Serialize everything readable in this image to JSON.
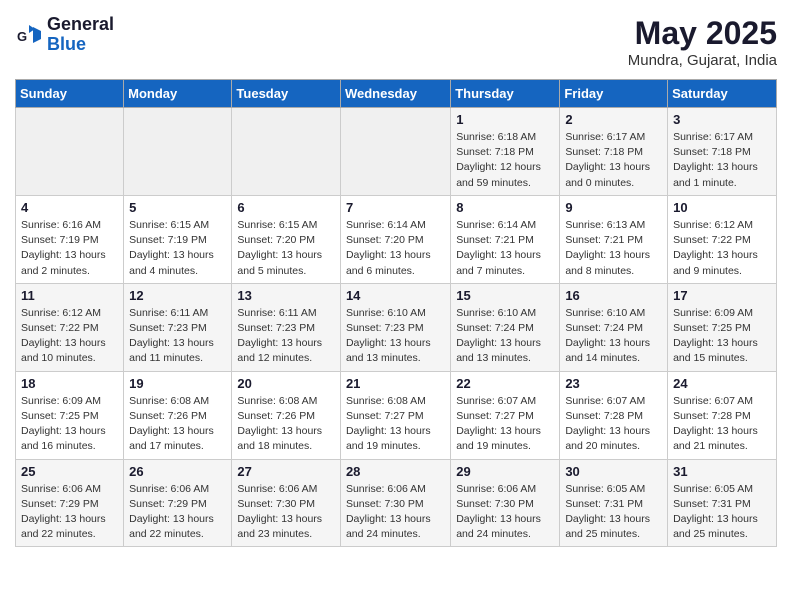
{
  "header": {
    "logo_line1": "General",
    "logo_line2": "Blue",
    "month": "May 2025",
    "location": "Mundra, Gujarat, India"
  },
  "weekdays": [
    "Sunday",
    "Monday",
    "Tuesday",
    "Wednesday",
    "Thursday",
    "Friday",
    "Saturday"
  ],
  "weeks": [
    [
      {
        "day": "",
        "info": ""
      },
      {
        "day": "",
        "info": ""
      },
      {
        "day": "",
        "info": ""
      },
      {
        "day": "",
        "info": ""
      },
      {
        "day": "1",
        "info": "Sunrise: 6:18 AM\nSunset: 7:18 PM\nDaylight: 12 hours\nand 59 minutes."
      },
      {
        "day": "2",
        "info": "Sunrise: 6:17 AM\nSunset: 7:18 PM\nDaylight: 13 hours\nand 0 minutes."
      },
      {
        "day": "3",
        "info": "Sunrise: 6:17 AM\nSunset: 7:18 PM\nDaylight: 13 hours\nand 1 minute."
      }
    ],
    [
      {
        "day": "4",
        "info": "Sunrise: 6:16 AM\nSunset: 7:19 PM\nDaylight: 13 hours\nand 2 minutes."
      },
      {
        "day": "5",
        "info": "Sunrise: 6:15 AM\nSunset: 7:19 PM\nDaylight: 13 hours\nand 4 minutes."
      },
      {
        "day": "6",
        "info": "Sunrise: 6:15 AM\nSunset: 7:20 PM\nDaylight: 13 hours\nand 5 minutes."
      },
      {
        "day": "7",
        "info": "Sunrise: 6:14 AM\nSunset: 7:20 PM\nDaylight: 13 hours\nand 6 minutes."
      },
      {
        "day": "8",
        "info": "Sunrise: 6:14 AM\nSunset: 7:21 PM\nDaylight: 13 hours\nand 7 minutes."
      },
      {
        "day": "9",
        "info": "Sunrise: 6:13 AM\nSunset: 7:21 PM\nDaylight: 13 hours\nand 8 minutes."
      },
      {
        "day": "10",
        "info": "Sunrise: 6:12 AM\nSunset: 7:22 PM\nDaylight: 13 hours\nand 9 minutes."
      }
    ],
    [
      {
        "day": "11",
        "info": "Sunrise: 6:12 AM\nSunset: 7:22 PM\nDaylight: 13 hours\nand 10 minutes."
      },
      {
        "day": "12",
        "info": "Sunrise: 6:11 AM\nSunset: 7:23 PM\nDaylight: 13 hours\nand 11 minutes."
      },
      {
        "day": "13",
        "info": "Sunrise: 6:11 AM\nSunset: 7:23 PM\nDaylight: 13 hours\nand 12 minutes."
      },
      {
        "day": "14",
        "info": "Sunrise: 6:10 AM\nSunset: 7:23 PM\nDaylight: 13 hours\nand 13 minutes."
      },
      {
        "day": "15",
        "info": "Sunrise: 6:10 AM\nSunset: 7:24 PM\nDaylight: 13 hours\nand 13 minutes."
      },
      {
        "day": "16",
        "info": "Sunrise: 6:10 AM\nSunset: 7:24 PM\nDaylight: 13 hours\nand 14 minutes."
      },
      {
        "day": "17",
        "info": "Sunrise: 6:09 AM\nSunset: 7:25 PM\nDaylight: 13 hours\nand 15 minutes."
      }
    ],
    [
      {
        "day": "18",
        "info": "Sunrise: 6:09 AM\nSunset: 7:25 PM\nDaylight: 13 hours\nand 16 minutes."
      },
      {
        "day": "19",
        "info": "Sunrise: 6:08 AM\nSunset: 7:26 PM\nDaylight: 13 hours\nand 17 minutes."
      },
      {
        "day": "20",
        "info": "Sunrise: 6:08 AM\nSunset: 7:26 PM\nDaylight: 13 hours\nand 18 minutes."
      },
      {
        "day": "21",
        "info": "Sunrise: 6:08 AM\nSunset: 7:27 PM\nDaylight: 13 hours\nand 19 minutes."
      },
      {
        "day": "22",
        "info": "Sunrise: 6:07 AM\nSunset: 7:27 PM\nDaylight: 13 hours\nand 19 minutes."
      },
      {
        "day": "23",
        "info": "Sunrise: 6:07 AM\nSunset: 7:28 PM\nDaylight: 13 hours\nand 20 minutes."
      },
      {
        "day": "24",
        "info": "Sunrise: 6:07 AM\nSunset: 7:28 PM\nDaylight: 13 hours\nand 21 minutes."
      }
    ],
    [
      {
        "day": "25",
        "info": "Sunrise: 6:06 AM\nSunset: 7:29 PM\nDaylight: 13 hours\nand 22 minutes."
      },
      {
        "day": "26",
        "info": "Sunrise: 6:06 AM\nSunset: 7:29 PM\nDaylight: 13 hours\nand 22 minutes."
      },
      {
        "day": "27",
        "info": "Sunrise: 6:06 AM\nSunset: 7:30 PM\nDaylight: 13 hours\nand 23 minutes."
      },
      {
        "day": "28",
        "info": "Sunrise: 6:06 AM\nSunset: 7:30 PM\nDaylight: 13 hours\nand 24 minutes."
      },
      {
        "day": "29",
        "info": "Sunrise: 6:06 AM\nSunset: 7:30 PM\nDaylight: 13 hours\nand 24 minutes."
      },
      {
        "day": "30",
        "info": "Sunrise: 6:05 AM\nSunset: 7:31 PM\nDaylight: 13 hours\nand 25 minutes."
      },
      {
        "day": "31",
        "info": "Sunrise: 6:05 AM\nSunset: 7:31 PM\nDaylight: 13 hours\nand 25 minutes."
      }
    ]
  ]
}
